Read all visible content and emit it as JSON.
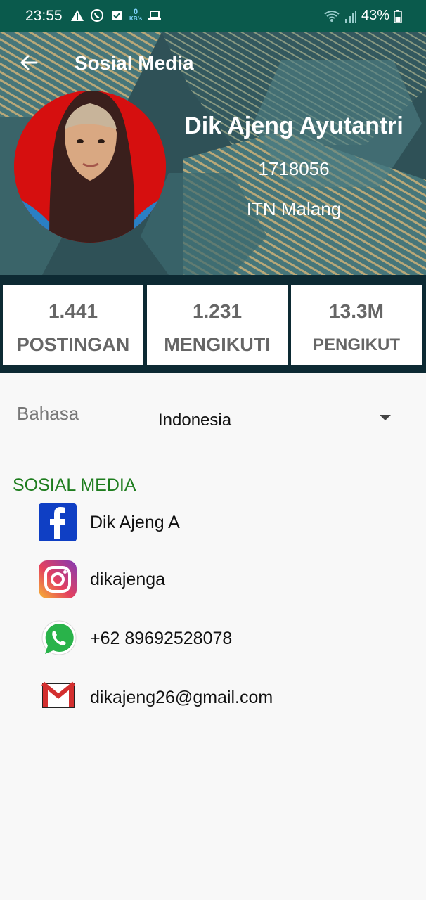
{
  "status_bar": {
    "time": "23:55",
    "speed_value": "0",
    "speed_unit": "KB/s",
    "battery": "43%"
  },
  "header": {
    "title": "Sosial Media",
    "name": "Dik Ajeng Ayutantri",
    "nim": "1718056",
    "campus": "ITN Malang"
  },
  "stats": [
    {
      "value": "1.441",
      "label": "POSTINGAN"
    },
    {
      "value": "1.231",
      "label": "MENGIKUTI"
    },
    {
      "value": "13.3M",
      "label": "PENGIKUT"
    }
  ],
  "language": {
    "label": "Bahasa",
    "value": "Indonesia"
  },
  "social": {
    "title": "SOSIAL MEDIA",
    "items": [
      {
        "icon": "facebook-icon",
        "text": "Dik Ajeng A"
      },
      {
        "icon": "instagram-icon",
        "text": "dikajenga"
      },
      {
        "icon": "whatsapp-icon",
        "text": "+62 89692528078"
      },
      {
        "icon": "gmail-icon",
        "text": "dikajeng26@gmail.com"
      }
    ]
  },
  "colors": {
    "status_bar": "#0a5a4c",
    "section_title": "#1e7d1e",
    "stats_band": "#0d2a33"
  }
}
